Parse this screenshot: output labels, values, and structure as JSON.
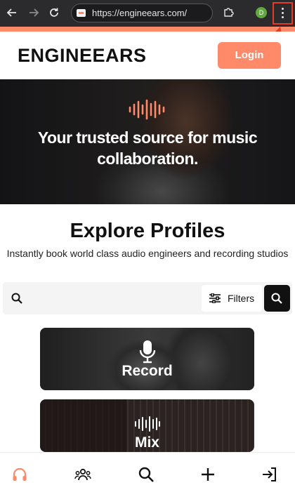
{
  "browser": {
    "url": "https://engineears.com/",
    "profile_initial": "D",
    "icons": [
      "back-arrow-icon",
      "forward-arrow-icon",
      "reload-icon",
      "extensions-puzzle-icon",
      "kebab-menu-icon"
    ]
  },
  "header": {
    "logo_text": "ENGINEEARS",
    "login_label": "Login"
  },
  "hero": {
    "title": "Your trusted source for music collaboration."
  },
  "explore": {
    "title": "Explore Profiles",
    "subtitle": "Instantly book world class audio engineers and recording studios"
  },
  "search": {
    "placeholder": "",
    "filters_label": "Filters"
  },
  "cards": [
    {
      "label": "Record",
      "icon": "microphone-icon"
    },
    {
      "label": "Mix",
      "icon": "waveform-icon"
    }
  ],
  "bottom_nav": {
    "items": [
      "headphones-icon",
      "community-icon",
      "search-icon",
      "plus-icon",
      "sign-in-icon"
    ],
    "active_color": "#ff8a6a"
  },
  "colors": {
    "accent": "#ff8a6a",
    "annotation": "#e53c28"
  }
}
